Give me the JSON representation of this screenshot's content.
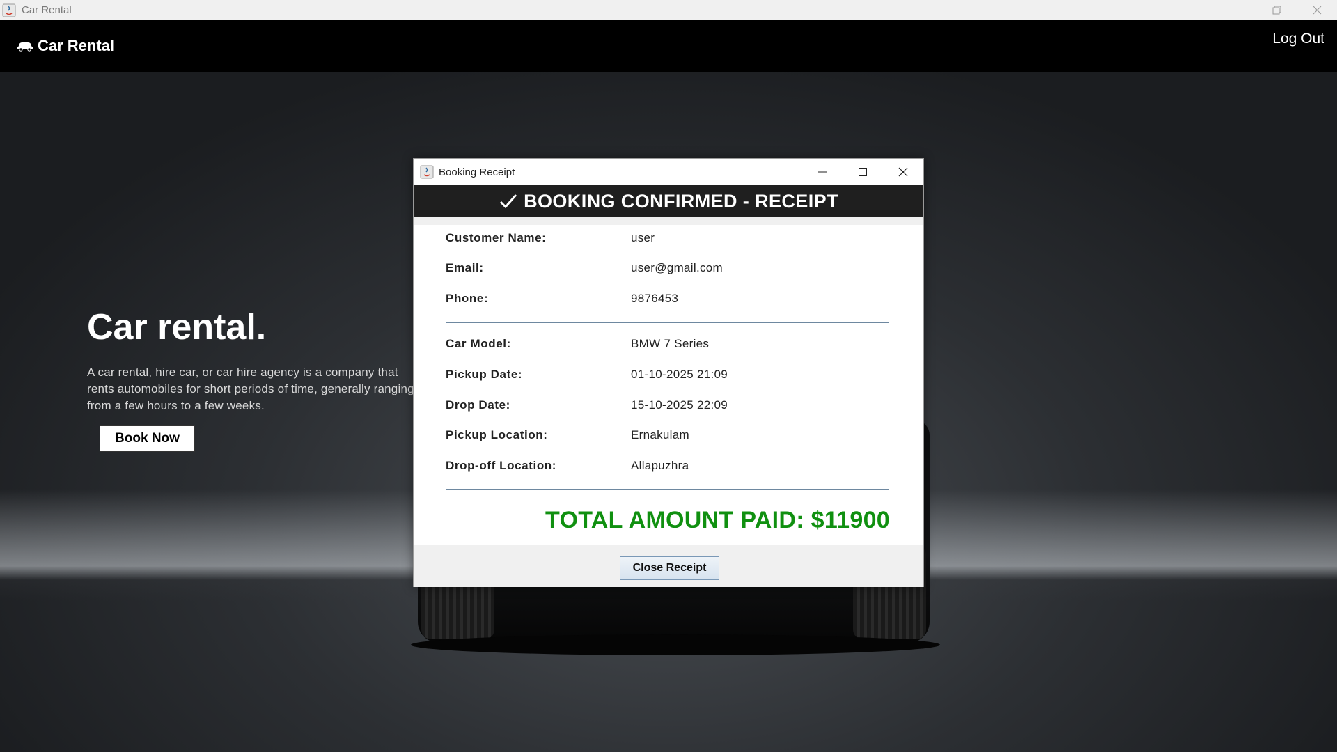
{
  "window": {
    "title": "Car Rental",
    "controls": [
      "minimize-icon",
      "restore-icon",
      "close-icon"
    ]
  },
  "nav": {
    "brand": "Car Rental",
    "brand_icon": "car-icon",
    "logout": "Log Out"
  },
  "hero": {
    "title": "Car rental.",
    "description": "A car rental, hire car, or car hire agency is a company that rents automobiles for short periods of time, generally ranging from a few hours to a few weeks.",
    "book_now": "Book Now"
  },
  "dialog": {
    "title": "Booking Receipt",
    "header": "BOOKING CONFIRMED - RECEIPT",
    "header_icon": "check-icon",
    "customer": [
      {
        "label": "Customer Name:",
        "value": "user"
      },
      {
        "label": "Email:",
        "value": "user@gmail.com"
      },
      {
        "label": "Phone:",
        "value": "9876453"
      }
    ],
    "booking": [
      {
        "label": "Car Model:",
        "value": "BMW 7 Series"
      },
      {
        "label": "Pickup Date:",
        "value": "01-10-2025 21:09"
      },
      {
        "label": "Drop Date:",
        "value": "15-10-2025 22:09"
      },
      {
        "label": "Pickup Location:",
        "value": "Ernakulam"
      },
      {
        "label": "Drop-off Location:",
        "value": "Allapuzhra"
      }
    ],
    "total": "TOTAL AMOUNT PAID: $11900",
    "close_button": "Close Receipt"
  },
  "colors": {
    "total_green": "#109010",
    "header_bg": "#1f1f1f",
    "separator": "#6e88a0"
  }
}
